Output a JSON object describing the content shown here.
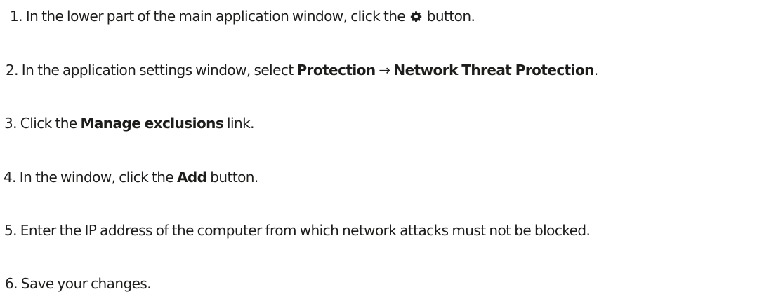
{
  "steps": [
    {
      "number": "1.",
      "before": "In the lower part of the main application window, click the",
      "icon": "gear-icon",
      "after": "button."
    },
    {
      "number": "2.",
      "before": "In the application settings window, select",
      "bold1": "Protection",
      "arrow": "→",
      "bold2": "Network Threat Protection",
      "after": "."
    },
    {
      "number": "3.",
      "before": "Click the",
      "bold": "Manage exclusions",
      "after": "link."
    },
    {
      "number": "4.",
      "before": "In the window, click the",
      "bold": "Add",
      "after": "button."
    },
    {
      "number": "5.",
      "text": "Enter the IP address of the computer from which network attacks must not be blocked."
    },
    {
      "number": "6.",
      "text": "Save your changes."
    }
  ]
}
